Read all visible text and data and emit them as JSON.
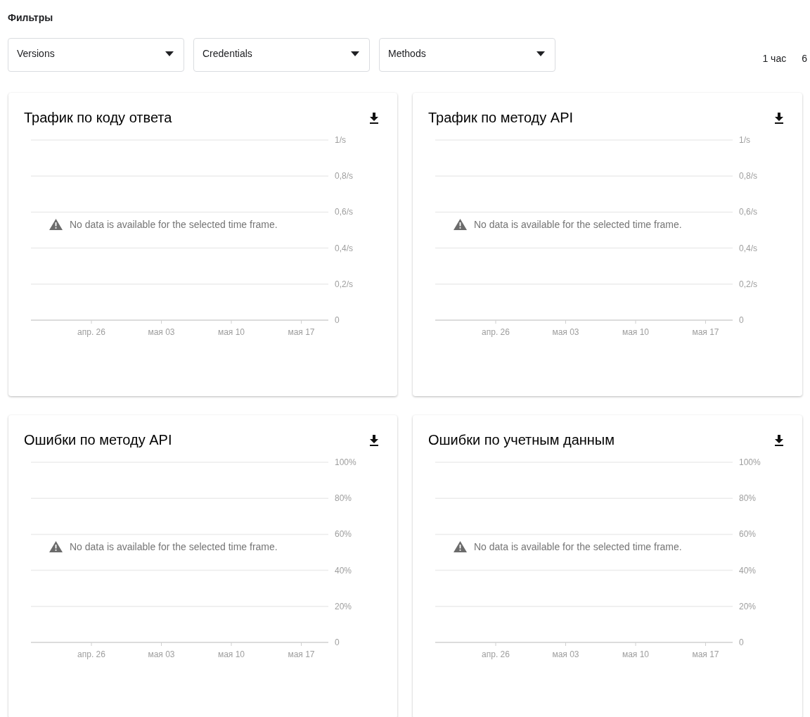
{
  "filters_title": "Фильтры",
  "filters": [
    {
      "label": "Versions"
    },
    {
      "label": "Credentials"
    },
    {
      "label": "Methods"
    }
  ],
  "time_range": [
    "1 час",
    "6"
  ],
  "cards": [
    {
      "title": "Трафик по коду ответа",
      "message": "No data is available for the selected time frame.",
      "chart_data": {
        "type": "line",
        "grid": true,
        "ylim": [
          0,
          1
        ],
        "categories": [
          "апр. 26",
          "мая 03",
          "мая 10",
          "мая 17"
        ],
        "yticks": [
          {
            "value": 0,
            "label": "0"
          },
          {
            "value": 0.2,
            "label": "0,2/s"
          },
          {
            "value": 0.4,
            "label": "0,4/s"
          },
          {
            "value": 0.6,
            "label": "0,6/s"
          },
          {
            "value": 0.8,
            "label": "0,8/s"
          },
          {
            "value": 1,
            "label": "1/s"
          }
        ]
      }
    },
    {
      "title": "Трафик по методу API",
      "message": "No data is available for the selected time frame.",
      "chart_data": {
        "type": "line",
        "grid": true,
        "ylim": [
          0,
          1
        ],
        "categories": [
          "апр. 26",
          "мая 03",
          "мая 10",
          "мая 17"
        ],
        "yticks": [
          {
            "value": 0,
            "label": "0"
          },
          {
            "value": 0.2,
            "label": "0,2/s"
          },
          {
            "value": 0.4,
            "label": "0,4/s"
          },
          {
            "value": 0.6,
            "label": "0,6/s"
          },
          {
            "value": 0.8,
            "label": "0,8/s"
          },
          {
            "value": 1,
            "label": "1/s"
          }
        ]
      }
    },
    {
      "title": "Ошибки по методу API",
      "message": "No data is available for the selected time frame.",
      "chart_data": {
        "type": "line",
        "grid": true,
        "ylim": [
          0,
          100
        ],
        "categories": [
          "апр. 26",
          "мая 03",
          "мая 10",
          "мая 17"
        ],
        "yticks": [
          {
            "value": 0,
            "label": "0"
          },
          {
            "value": 20,
            "label": "20%"
          },
          {
            "value": 40,
            "label": "40%"
          },
          {
            "value": 60,
            "label": "60%"
          },
          {
            "value": 80,
            "label": "80%"
          },
          {
            "value": 100,
            "label": "100%"
          }
        ]
      }
    },
    {
      "title": "Ошибки по учетным данным",
      "message": "No data is available for the selected time frame.",
      "chart_data": {
        "type": "line",
        "grid": true,
        "ylim": [
          0,
          100
        ],
        "categories": [
          "апр. 26",
          "мая 03",
          "мая 10",
          "мая 17"
        ],
        "yticks": [
          {
            "value": 0,
            "label": "0"
          },
          {
            "value": 20,
            "label": "20%"
          },
          {
            "value": 40,
            "label": "40%"
          },
          {
            "value": 60,
            "label": "60%"
          },
          {
            "value": 80,
            "label": "80%"
          },
          {
            "value": 100,
            "label": "100%"
          }
        ]
      }
    }
  ]
}
